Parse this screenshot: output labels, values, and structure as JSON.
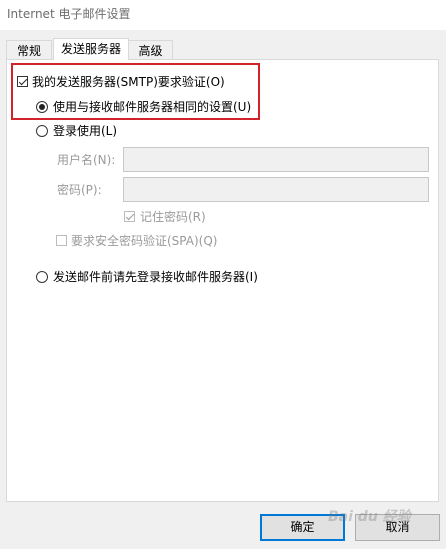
{
  "window": {
    "title": "Internet 电子邮件设置"
  },
  "tabs": [
    {
      "label": "常规",
      "active": false
    },
    {
      "label": "发送服务器",
      "active": true
    },
    {
      "label": "高级",
      "active": false
    }
  ],
  "outgoing": {
    "smtp_auth_label": "我的发送服务器(SMTP)要求验证(O)",
    "smtp_auth_checked": true,
    "same_settings_label": "使用与接收邮件服务器相同的设置(U)",
    "login_using_label": "登录使用(L)",
    "username_label": "用户名(N):",
    "username_value": "",
    "password_label": "密码(P):",
    "password_value": "",
    "remember_password_label": "记住密码(R)",
    "remember_password_checked": true,
    "spa_label": "要求安全密码验证(SPA)(Q)",
    "spa_checked": false,
    "login_before_send_label": "发送邮件前请先登录接收邮件服务器(I)"
  },
  "buttons": {
    "ok": "确定",
    "cancel": "取消"
  },
  "watermark": "Bai du 经验",
  "colors": {
    "highlight": "#d2232a",
    "default_button_border": "#0078d7"
  }
}
